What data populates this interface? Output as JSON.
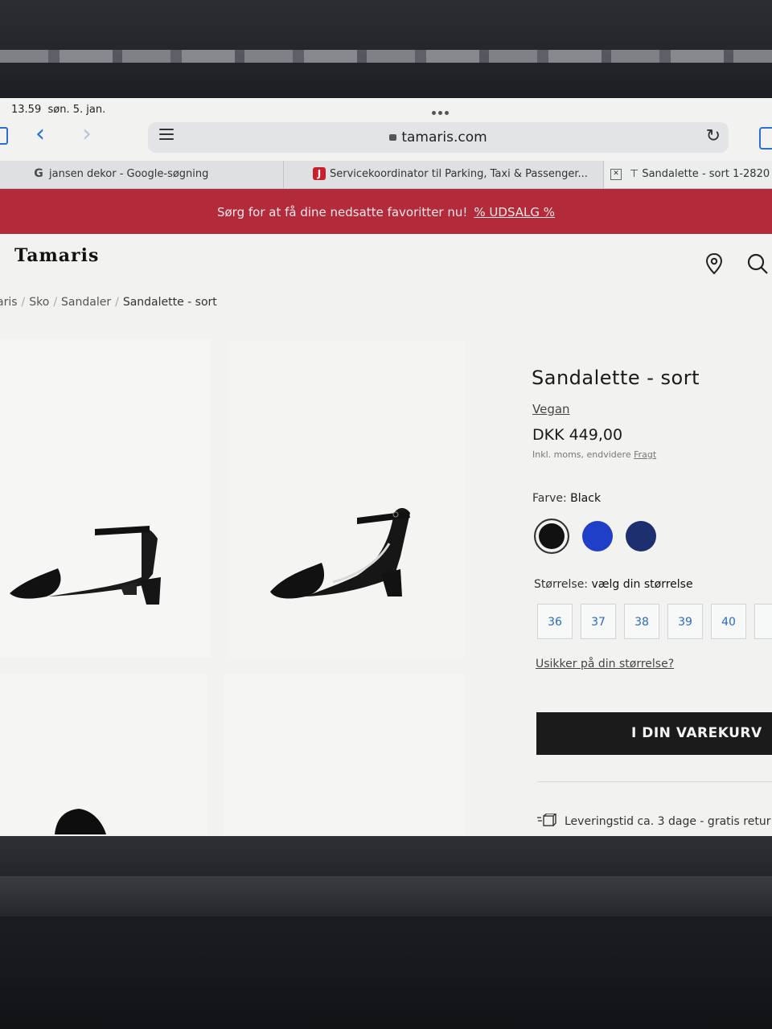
{
  "status_bar": {
    "time": "13.59",
    "date": "søn. 5. jan."
  },
  "browser": {
    "url": "tamaris.com",
    "tabs": [
      {
        "label": "jansen dekor - Google-søgning"
      },
      {
        "label": "Servicekoordinator til Parking, Taxi & Passenger..."
      },
      {
        "label": "Sandalette - sort 1-2820"
      }
    ]
  },
  "promo": {
    "text": "Sørg for at få dine nedsatte favoritter nu!",
    "link": "% UDSALG %"
  },
  "header": {
    "logo": "Tamaris"
  },
  "breadcrumb": [
    "aris",
    "Sko",
    "Sandaler",
    "Sandalette - sort"
  ],
  "product": {
    "title": "Sandalette - sort",
    "tag": "Vegan",
    "price": "DKK 449,00",
    "tax_note": "Inkl. moms, endvidere",
    "tax_link": "Fragt",
    "color_label": "Farve:",
    "color_value": "Black",
    "swatches": [
      {
        "name": "Black",
        "color": "#111111"
      },
      {
        "name": "Blue",
        "color": "#1f3fc8"
      },
      {
        "name": "Navy",
        "color": "#1d2f6e"
      }
    ],
    "size_label": "Størrelse:",
    "size_prompt": "vælg din størrelse",
    "sizes": [
      "36",
      "37",
      "38",
      "39",
      "40"
    ],
    "size_help": "Usikker på din størrelse?",
    "cart_button": "I DIN VAREKURV",
    "delivery": "Leveringstid ca. 3 dage - gratis retur"
  }
}
